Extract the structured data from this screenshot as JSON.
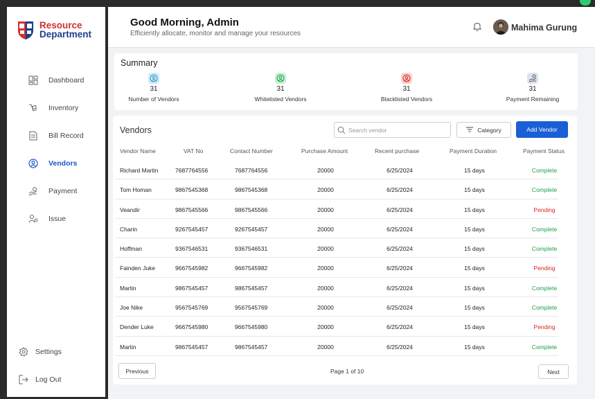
{
  "brand": {
    "line1": "Resource",
    "line2": "Department"
  },
  "header": {
    "greeting": "Good Morning, Admin",
    "subtitle": "Efficiently allocate, monitor and manage your resources",
    "user_name": "Mahima Gurung"
  },
  "sidebar": {
    "items": [
      {
        "label": "Dashboard",
        "icon": "dashboard-icon"
      },
      {
        "label": "Inventory",
        "icon": "inventory-icon"
      },
      {
        "label": "Bill Record",
        "icon": "bill-icon"
      },
      {
        "label": "Vendors",
        "icon": "vendors-icon",
        "active": true
      },
      {
        "label": "Payment",
        "icon": "payment-icon"
      },
      {
        "label": "Issue",
        "icon": "issue-icon"
      }
    ],
    "bottom": [
      {
        "label": "Settings",
        "icon": "gear-icon"
      },
      {
        "label": "Log Out",
        "icon": "logout-icon"
      }
    ]
  },
  "summary": {
    "title": "Summary",
    "stats": [
      {
        "value": "31",
        "label": "Number of Vendors",
        "color": "#cfe9f7"
      },
      {
        "value": "31",
        "label": "Whitelisted Vendors",
        "color": "#c9f2d6"
      },
      {
        "value": "31",
        "label": "Blacklisted Vendors",
        "color": "#fbd3d3"
      },
      {
        "value": "31",
        "label": "Payment Remaining",
        "color": "#dde3ea"
      }
    ]
  },
  "vendors": {
    "title": "Vendors",
    "search_placeholder": "Search vendor",
    "category_label": "Category",
    "add_label": "Add Vendor",
    "columns": [
      "Vendor Name",
      "VAT No",
      "Contact Number",
      "Purchase Amount",
      "Recent purchase",
      "Payment Duration",
      "Payment Status"
    ],
    "rows": [
      {
        "name": "Richard Martin",
        "vat": "7687764556",
        "contact": "7687764556",
        "amount": "20000",
        "date": "6/25/2024",
        "duration": "15 days",
        "status": "Complete"
      },
      {
        "name": "Tom Homan",
        "vat": "9867545368",
        "contact": "9867545368",
        "amount": "20000",
        "date": "6/25/2024",
        "duration": "15 days",
        "status": "Complete"
      },
      {
        "name": "Veandir",
        "vat": "9867545566",
        "contact": "9867545566",
        "amount": "20000",
        "date": "6/25/2024",
        "duration": "15 days",
        "status": "Pending"
      },
      {
        "name": "Charin",
        "vat": "9267545457",
        "contact": "9267545457",
        "amount": "20000",
        "date": "6/25/2024",
        "duration": "15 days",
        "status": "Complete"
      },
      {
        "name": "Hoffman",
        "vat": "9367546531",
        "contact": "9367546531",
        "amount": "20000",
        "date": "6/25/2024",
        "duration": "15 days",
        "status": "Complete"
      },
      {
        "name": "Fainden Juke",
        "vat": "9667545982",
        "contact": "9667545982",
        "amount": "20000",
        "date": "6/25/2024",
        "duration": "15 days",
        "status": "Pending"
      },
      {
        "name": "Martin",
        "vat": "9867545457",
        "contact": "9867545457",
        "amount": "20000",
        "date": "6/25/2024",
        "duration": "15 days",
        "status": "Complete"
      },
      {
        "name": "Joe Nike",
        "vat": "9567545769",
        "contact": "9567545769",
        "amount": "20000",
        "date": "6/25/2024",
        "duration": "15 days",
        "status": "Complete"
      },
      {
        "name": "Dender Luke",
        "vat": "9667545980",
        "contact": "9667545980",
        "amount": "20000",
        "date": "6/25/2024",
        "duration": "15 days",
        "status": "Pending"
      },
      {
        "name": "Martin",
        "vat": "9867545457",
        "contact": "9867545457",
        "amount": "20000",
        "date": "6/25/2024",
        "duration": "15 days",
        "status": "Complete"
      }
    ],
    "pagination": {
      "prev": "Previous",
      "page_prefix": "Page ",
      "current": "1",
      "page_mid": " of ",
      "total": "10",
      "next": "Next"
    }
  },
  "colors": {
    "accent": "#1a5fd6",
    "complete": "#1e9e4a",
    "pending": "#d9261c",
    "brand_red": "#d32f2f",
    "brand_navy": "#1f3d8a"
  }
}
